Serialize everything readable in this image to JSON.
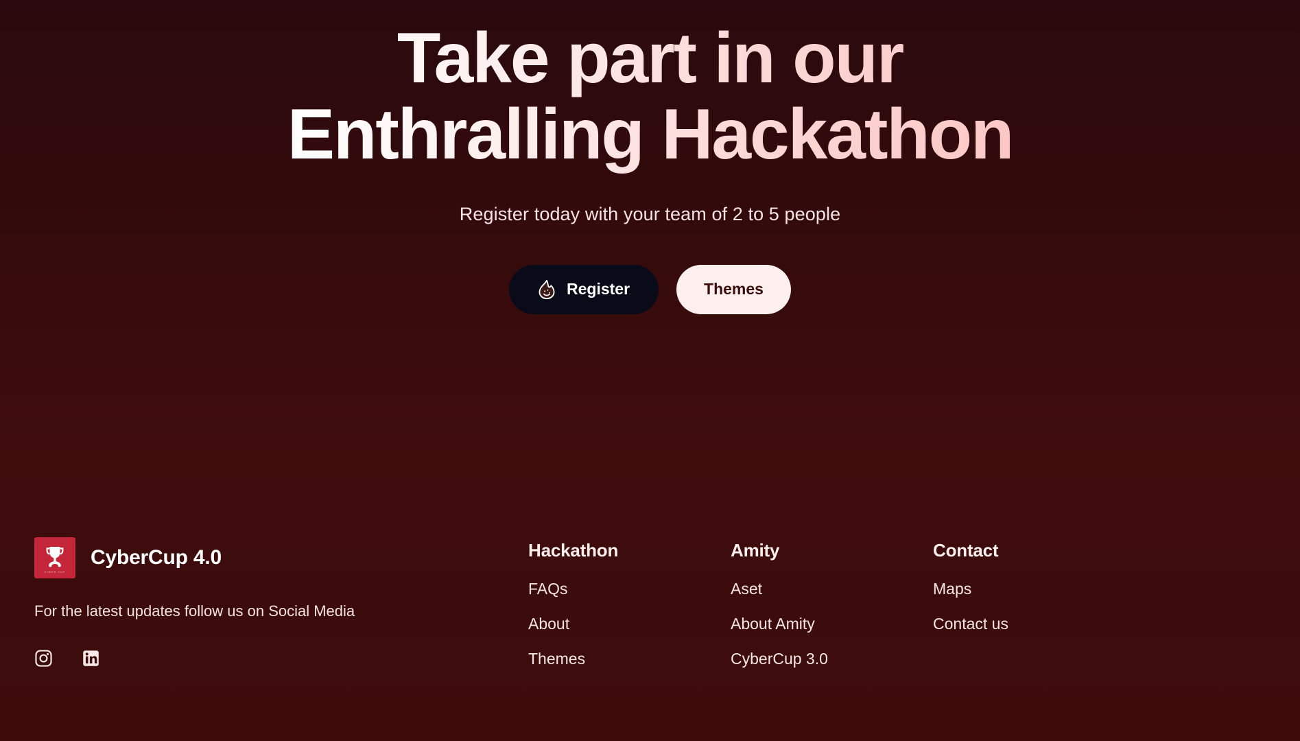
{
  "hero": {
    "title": "Take part in our Enthralling Hackathon",
    "subtitle": "Register today with your team of 2 to 5 people",
    "register_label": "Register",
    "themes_label": "Themes",
    "register_icon": "flame-icon"
  },
  "footer": {
    "brand_name": "CyberCup 4.0",
    "logo_icon": "trophy-icon",
    "logo_caption": "CYBER CUP",
    "tagline": "For the latest updates follow us on Social Media",
    "socials": [
      {
        "name": "instagram-icon"
      },
      {
        "name": "linkedin-icon"
      }
    ],
    "columns": [
      {
        "title": "Hackathon",
        "links": [
          "FAQs",
          "About",
          "Themes"
        ]
      },
      {
        "title": "Amity",
        "links": [
          "Aset",
          "About Amity",
          "CyberCup 3.0"
        ]
      },
      {
        "title": "Contact",
        "links": [
          "Maps",
          "Contact us"
        ]
      }
    ]
  },
  "colors": {
    "background_top": "#2a0a0e",
    "background_bottom": "#3e0b0b",
    "accent_red": "#c22638",
    "register_bg": "#0a0b18",
    "themes_bg": "#fcefee",
    "themes_text": "#3b0d0d",
    "title_gradient_start": "#ffffff",
    "title_gradient_end": "#fcc7c6"
  }
}
